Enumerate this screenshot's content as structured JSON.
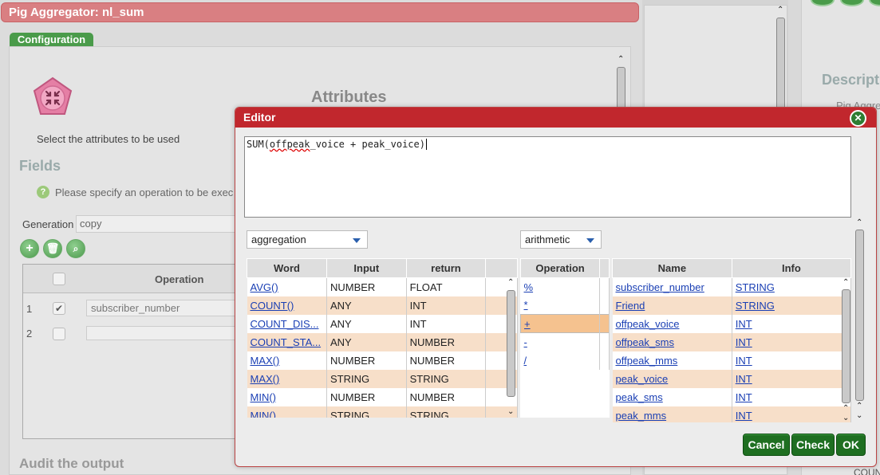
{
  "main_window": {
    "title": "Pig Aggregator: nl_sum",
    "tab": "Configuration",
    "select_hint": "Select the attributes to be used",
    "attributes_heading": "Attributes",
    "fields_heading": "Fields",
    "specify_hint": "Please specify an operation to be exec",
    "generation_label": "Generation",
    "generation_value": "copy",
    "grid_header_operation": "Operation",
    "rows": [
      {
        "num": "1",
        "checked": "✔",
        "value": "subscriber_number"
      },
      {
        "num": "2",
        "checked": "",
        "value": ""
      }
    ],
    "audit_heading": "Audit the output"
  },
  "right_panel": {
    "heading": "Descript",
    "subtitle": "Pig Aggre",
    "footer": "COUNT"
  },
  "editor": {
    "title": "Editor",
    "expression_text": "SUM(",
    "expression_word": "offpeak",
    "expression_rest": "_voice + peak_voice)",
    "function_category": "aggregation",
    "operator_category": "arithmetic",
    "functions": {
      "headers": [
        "Word",
        "Input",
        "return"
      ],
      "rows": [
        [
          "AVG()",
          "NUMBER",
          "FLOAT"
        ],
        [
          "COUNT()",
          "ANY",
          "INT"
        ],
        [
          "COUNT_DIS...",
          "ANY",
          "INT"
        ],
        [
          "COUNT_STA...",
          "ANY",
          "NUMBER"
        ],
        [
          "MAX()",
          "NUMBER",
          "NUMBER"
        ],
        [
          "MAX()",
          "STRING",
          "STRING"
        ],
        [
          "MIN()",
          "NUMBER",
          "NUMBER"
        ],
        [
          "MIN()",
          "STRING",
          "STRING"
        ]
      ]
    },
    "operations": {
      "header": "Operation",
      "rows": [
        "%",
        "*",
        "+",
        "-",
        "/"
      ],
      "selected_index": 2
    },
    "fields": {
      "headers": [
        "Name",
        "Info"
      ],
      "rows": [
        [
          "subscriber_number",
          "STRING"
        ],
        [
          "Friend",
          "STRING"
        ],
        [
          "offpeak_voice",
          "INT"
        ],
        [
          "offpeak_sms",
          "INT"
        ],
        [
          "offpeak_mms",
          "INT"
        ],
        [
          "peak_voice",
          "INT"
        ],
        [
          "peak_sms",
          "INT"
        ],
        [
          "peak_mms",
          "INT"
        ]
      ]
    },
    "buttons": {
      "cancel": "Cancel",
      "check": "Check",
      "ok": "OK"
    }
  },
  "colors": {
    "title_bar_main": "#d97f82",
    "title_bar_editor": "#c1272d",
    "button_green": "#1f6f21",
    "row_alt": "#f7dfc9",
    "row_selected": "#f5c28f",
    "link": "#1a3fb4"
  },
  "icons": [
    "node-shrink-icon",
    "help-icon",
    "add-icon",
    "delete-icon",
    "search-icon",
    "close-icon",
    "check-icon",
    "dropdown-arrow-icon"
  ]
}
